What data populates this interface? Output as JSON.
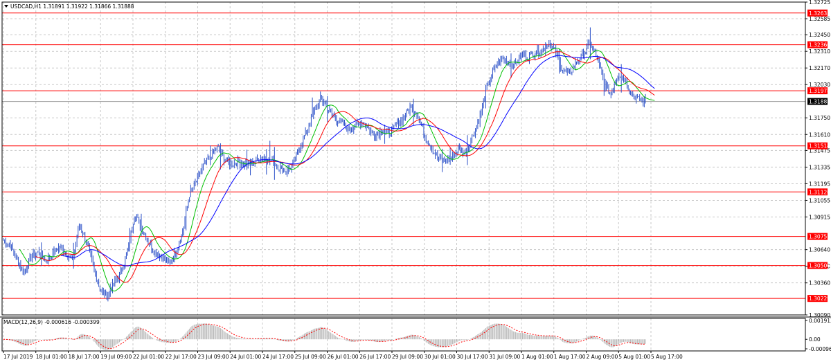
{
  "window_title": "USDCAD,H1  1.31891 1.31922 1.31866 1.31888",
  "chart_data": {
    "type": "candlestick",
    "symbol": "USDCAD",
    "timeframe": "H1",
    "header": {
      "open": "1.31891",
      "high": "1.31922",
      "low": "1.31866",
      "close": "1.31888"
    },
    "ylim": [
      1.3009,
      1.32725
    ],
    "y_ticks": [
      "1.32725",
      "1.32585",
      "1.32450",
      "1.32310",
      "1.32170",
      "1.32030",
      "1.31750",
      "1.31610",
      "1.31475",
      "1.31335",
      "1.31195",
      "1.31055",
      "1.30915",
      "1.30640",
      "1.30500",
      "1.30360",
      "1.30090"
    ],
    "x_ticks": [
      "17 Jul 2019",
      "18 Jul 01:00",
      "18 Jul 17:00",
      "19 Jul 09:00",
      "22 Jul 01:00",
      "22 Jul 17:00",
      "23 Jul 09:00",
      "24 Jul 01:00",
      "24 Jul 17:00",
      "25 Jul 09:00",
      "26 Jul 01:00",
      "26 Jul 17:00",
      "29 Jul 09:00",
      "30 Jul 01:00",
      "30 Jul 17:00",
      "31 Jul 09:00",
      "1 Aug 01:00",
      "1 Aug 17:00",
      "2 Aug 09:00",
      "5 Aug 01:00",
      "5 Aug 17:00"
    ],
    "current_price": "1.31888",
    "levels": [
      "1.32633",
      "1.32366",
      "1.31978",
      "1.31514",
      "1.31126",
      "1.30751",
      "1.30506",
      "1.30229"
    ],
    "price_path": [
      1.3072,
      1.3068,
      1.3055,
      1.3045,
      1.3058,
      1.3062,
      1.3055,
      1.306,
      1.3066,
      1.3062,
      1.3055,
      1.3085,
      1.3072,
      1.305,
      1.303,
      1.3025,
      1.3035,
      1.3045,
      1.3062,
      1.3095,
      1.3082,
      1.307,
      1.3062,
      1.3058,
      1.3052,
      1.3062,
      1.308,
      1.3112,
      1.3122,
      1.3135,
      1.3142,
      1.315,
      1.314,
      1.3136,
      1.3138,
      1.3136,
      1.3137,
      1.314,
      1.3142,
      1.3138,
      1.3133,
      1.313,
      1.3135,
      1.3152,
      1.3165,
      1.318,
      1.3192,
      1.3182,
      1.3175,
      1.317,
      1.3165,
      1.3168,
      1.3172,
      1.3165,
      1.316,
      1.3165,
      1.3162,
      1.317,
      1.3175,
      1.3185,
      1.3178,
      1.316,
      1.315,
      1.314,
      1.3138,
      1.3142,
      1.315,
      1.3145,
      1.316,
      1.3175,
      1.32,
      1.3215,
      1.3225,
      1.3222,
      1.322,
      1.3228,
      1.3226,
      1.323,
      1.3232,
      1.3238,
      1.323,
      1.3215,
      1.3212,
      1.3222,
      1.3228,
      1.3238,
      1.3225,
      1.3205,
      1.3195,
      1.3212,
      1.3208,
      1.3195,
      1.319,
      1.3189
    ],
    "moving_averages": [
      {
        "color": "#00c000"
      },
      {
        "color": "#ff0000"
      },
      {
        "color": "#0000ff"
      }
    ],
    "macd": {
      "label": "MACD(12,26,9) -0.000616 -0.000399",
      "y_ticks": [
        "0.001913",
        "0.00",
        "-0.000968"
      ],
      "ylim": [
        -0.000968,
        0.001913
      ],
      "hist_color": "#b4b4b4",
      "signal_color": "#ff0000"
    },
    "grid": true,
    "colors": {
      "candles": "#2b50c8",
      "level_line": "#ff0000",
      "level_label_bg": "#ff0000",
      "current_label_bg": "#000000",
      "grid": "#c8c8c8"
    }
  }
}
